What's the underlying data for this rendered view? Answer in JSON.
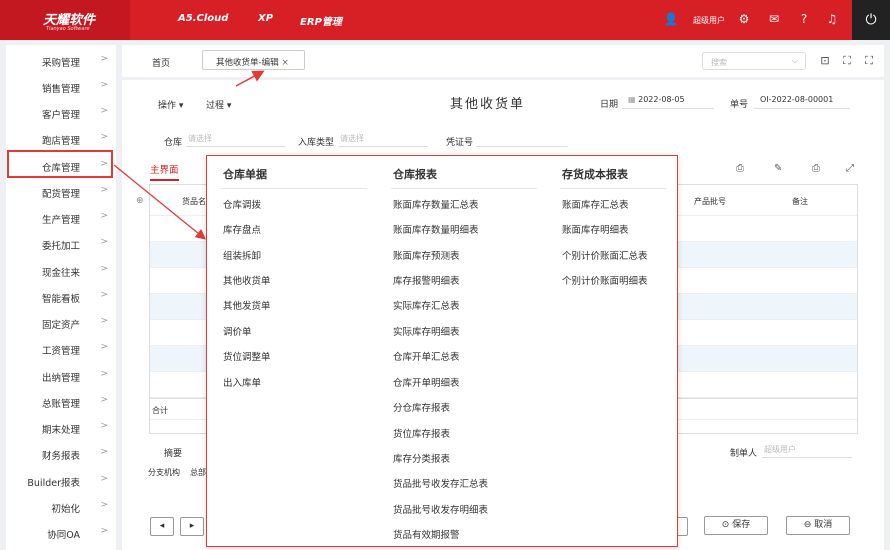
{
  "brand": {
    "name": "天耀软件",
    "sub": "Tianyao Software"
  },
  "nav": [
    "A5.Cloud",
    "XP",
    "ERP管理"
  ],
  "user": "超级用户",
  "sidebar": [
    "采购管理",
    "销售管理",
    "客户管理",
    "跑店管理",
    "仓库管理",
    "配货管理",
    "生产管理",
    "委托加工",
    "现金往来",
    "智能看板",
    "固定资产",
    "工资管理",
    "出纳管理",
    "总账管理",
    "期末处理",
    "财务报表",
    "Builder报表",
    "初始化",
    "协同OA"
  ],
  "tabs": {
    "home": "首页",
    "active": "其他收货单-编辑",
    "close": "×"
  },
  "search": {
    "placeholder": "搜索"
  },
  "form": {
    "op": "操作",
    "process": "过程",
    "title": "其他收货单",
    "date_label": "日期",
    "date_value": "2022-08-05",
    "no_label": "单号",
    "no_value": "OI-2022-08-00001",
    "warehouse_label": "仓库",
    "warehouse_ph": "请选择",
    "intype_label": "入库类型",
    "intype_ph": "请选择",
    "voucher_label": "凭证号",
    "main_tab": "主界面",
    "col_goods": "货品名",
    "col_batch": "产品批号",
    "col_note": "备注",
    "total": "合计",
    "summary_label": "摘要",
    "branch_label": "分支机构",
    "branch_value": "总部",
    "maker_label": "制单人",
    "maker_ph": "超级用户",
    "save": "保存",
    "cancel": "取消"
  },
  "menu": [
    {
      "title": "仓库单据",
      "items": [
        "仓库调拨",
        "库存盘点",
        "组装拆卸",
        "其他收货单",
        "其他发货单",
        "调价单",
        "货位调整单",
        "出入库单"
      ]
    },
    {
      "title": "仓库报表",
      "items": [
        "账面库存数量汇总表",
        "账面库存数量明细表",
        "账面库存预测表",
        "库存报警明细表",
        "实际库存汇总表",
        "实际库存明细表",
        "仓库开单汇总表",
        "仓库开单明细表",
        "分仓库存报表",
        "货位库存报表",
        "库存分类报表",
        "货品批号收发存汇总表",
        "货品批号收发存明细表",
        "货品有效期报警"
      ]
    },
    {
      "title": "存货成本报表",
      "items": [
        "账面库存汇总表",
        "账面库存明细表",
        "个别计价账面汇总表",
        "个别计价账面明细表"
      ]
    }
  ],
  "colors": {
    "brand_red": "#d71f26",
    "highlight": "#e53935"
  }
}
